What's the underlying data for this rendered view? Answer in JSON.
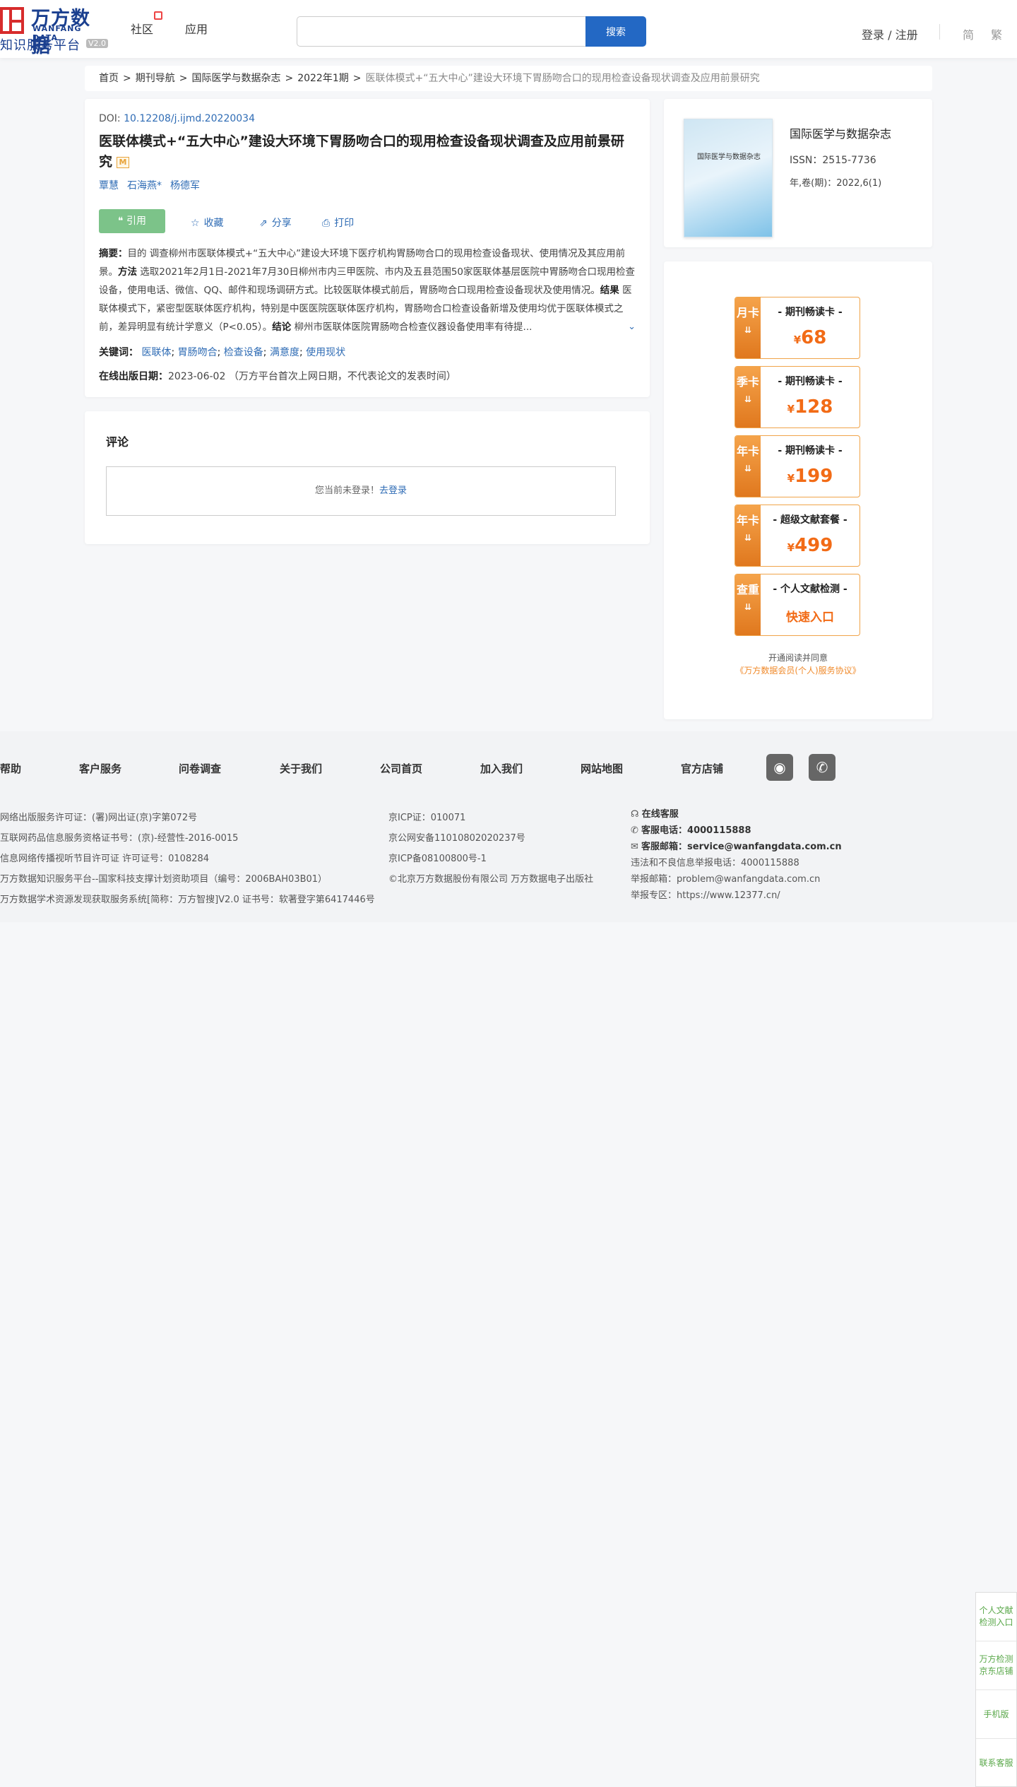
{
  "header": {
    "logo_cn": "万方数据",
    "logo_en": "WANFANG DATA",
    "logo_sub": "知识服务平台",
    "logo_version": "V2.0",
    "nav_community": "社区",
    "nav_apps": "应用",
    "search_placeholder": "",
    "search_button": "搜索",
    "login": "登录 / 注册",
    "lang_simplified": "简",
    "lang_traditional": "繁"
  },
  "breadcrumb": [
    "首页",
    "期刊导航",
    "国际医学与数据杂志",
    "2022年1期",
    "医联体模式+“五大中心”建设大环境下胃肠吻合口的现用检查设备现状调查及应用前景研究"
  ],
  "article": {
    "doi_label": "DOI:",
    "doi": "10.12208/j.ijmd.20220034",
    "title": "医联体模式+“五大中心”建设大环境下胃肠吻合口的现用检查设备现状调查及应用前景研究",
    "badge": "M",
    "authors": [
      "覃慧",
      "石海燕*",
      "杨德军"
    ],
    "actions": {
      "cite": "引用",
      "favorite": "收藏",
      "share": "分享",
      "print": "打印"
    },
    "abstract_label": "摘要：",
    "abstract_text": "目的 调查柳州市医联体模式+“五大中心”建设大环境下医疗机构胃肠吻合口的现用检查设备现状、使用情况及其应用前景。",
    "abstract_method_label": "方法",
    "abstract_method": "选取2021年2月1日-2021年7月30日柳州市内三甲医院、市内及五县范围50家医联体基层医院中胃肠吻合口现用检查设备，使用电话、微信、QQ、邮件和现场调研方式。比较医联体模式前后，胃肠吻合口现用检查设备现状及使用情况。",
    "abstract_result_label": "结果",
    "abstract_result": "医联体模式下，紧密型医联体医疗机构，特别是中医医院医联体医疗机构，胃肠吻合口检查设备新增及使用均优于医联体模式之前，差异明显有统计学意义（P<0.05）。",
    "abstract_concl_label": "结论",
    "abstract_concl": "柳州市医联体医院胃肠吻合检查仪器设备使用率有待提...",
    "keywords_label": "关键词：",
    "keywords": [
      "医联体",
      "胃肠吻合",
      "检查设备",
      "满意度",
      "使用现状"
    ],
    "pubdate_label": "在线出版日期：",
    "pubdate": "2023-06-02",
    "pubdate_note": "（万方平台首次上网日期，不代表论文的发表时间）"
  },
  "comment": {
    "title": "评论",
    "not_logged": "您当前未登录！",
    "login_link": "去登录"
  },
  "journal": {
    "cover_title": "国际医学与数据杂志",
    "name": "国际医学与数据杂志",
    "issn": "ISSN：2515-7736",
    "issue": "年,卷(期)：2022,6(1)"
  },
  "promo": {
    "cards": [
      {
        "tab": "月卡",
        "label": "- 期刊畅读卡 -",
        "currency": "¥",
        "price": "68"
      },
      {
        "tab": "季卡",
        "label": "- 期刊畅读卡 -",
        "currency": "¥",
        "price": "128"
      },
      {
        "tab": "年卡",
        "label": "- 期刊畅读卡 -",
        "currency": "¥",
        "price": "199"
      },
      {
        "tab": "年卡",
        "label": "- 超级文献套餐 -",
        "currency": "¥",
        "price": "499"
      },
      {
        "tab": "查重",
        "label": "- 个人文献检测 -",
        "entry": "快速入口"
      }
    ],
    "note": "开通阅读并同意",
    "agreement": "《万方数据会员(个人)服务协议》"
  },
  "footer": {
    "nav": [
      "帮助",
      "客户服务",
      "问卷调查",
      "关于我们",
      "公司首页",
      "加入我们",
      "网站地图",
      "官方店铺"
    ],
    "col1": [
      "网络出版服务许可证：(署)网出证(京)字第072号",
      "互联网药品信息服务资格证书号：(京)-经营性-2016-0015",
      "信息网络传播视听节目许可证 许可证号：0108284",
      "万方数据知识服务平台--国家科技支撑计划资助项目（编号：2006BAH03B01）",
      "万方数据学术资源发现获取服务系统[简称：万方智搜]V2.0 证书号：软著登字第6417446号"
    ],
    "col2": [
      "京ICP证：010071",
      "京公网安备11010802020237号",
      "京ICP备08100800号-1",
      "©北京万方数据股份有限公司 万方数据电子出版社"
    ],
    "col3": {
      "online_service": "在线客服",
      "phone_label": "客服电话：",
      "phone": "4000115888",
      "email_label": "客服邮箱：",
      "email": "service@wanfangdata.com.cn",
      "report_phone": "违法和不良信息举报电话：4000115888",
      "report_email": "举报邮箱：problem@wanfangdata.com.cn",
      "report_zone": "举报专区：https://www.12377.cn/"
    }
  },
  "side": [
    "个人文献检测入口",
    "万方检测京东店铺",
    "手机版",
    "联系客服"
  ],
  "colors": {
    "brand": "#2368c4",
    "accent": "#f26b16",
    "cite_green": "#7cc389"
  }
}
